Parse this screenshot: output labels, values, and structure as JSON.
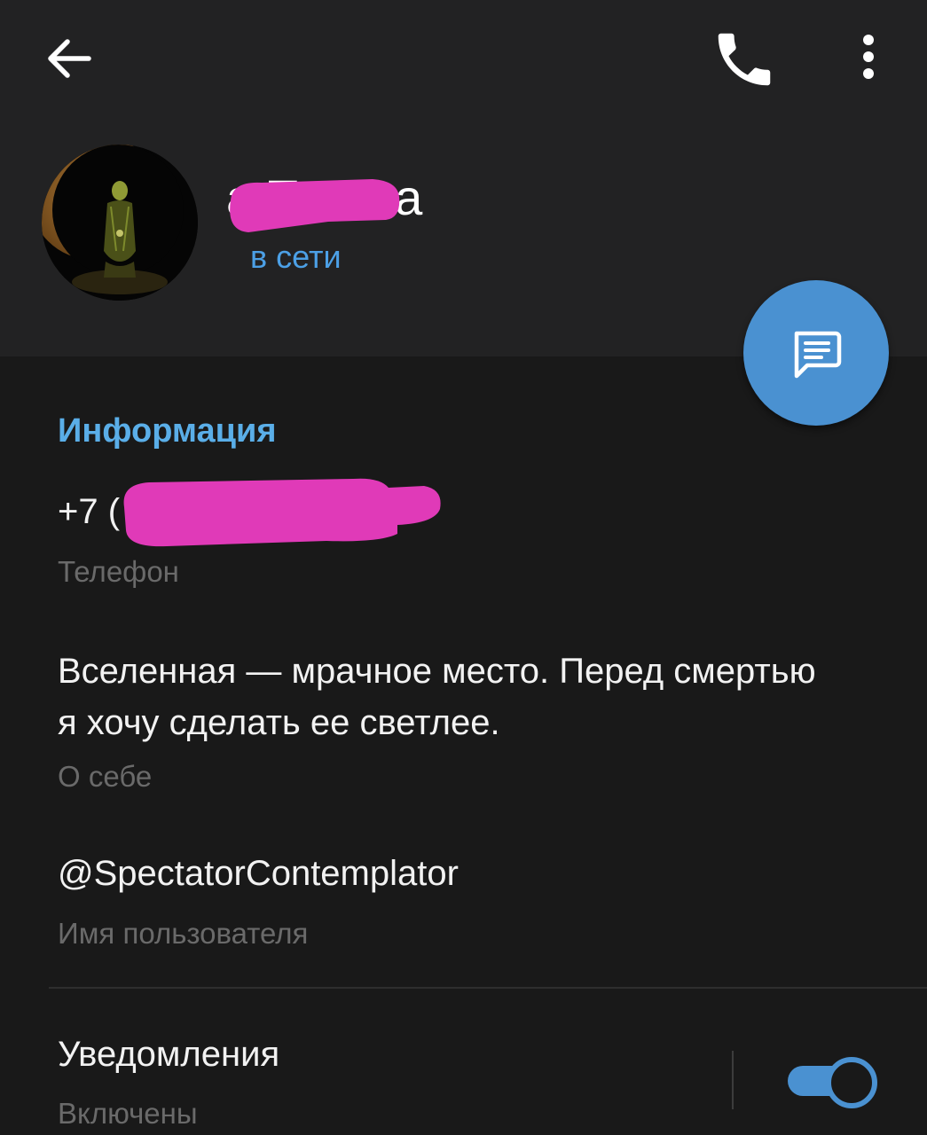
{
  "toolbar": {
    "back_icon": "arrow-back-icon",
    "call_icon": "phone-icon",
    "more_icon": "more-vertical-icon"
  },
  "profile": {
    "name_visible": "а Телега",
    "status": "в сети",
    "accent_color": "#4ca0e6"
  },
  "fab": {
    "icon": "message-icon",
    "color": "#4a91d1"
  },
  "info": {
    "section_title": "Информация",
    "phone": {
      "value": "+7 (",
      "label": "Телефон"
    },
    "bio": {
      "value": "Вселенная — мрачное место. Перед смертью я хочу сделать ее светлее.",
      "label": "О себе"
    },
    "username": {
      "value": "@SpectatorContemplator",
      "label": "Имя пользователя"
    }
  },
  "notifications": {
    "title": "Уведомления",
    "status": "Включены",
    "enabled": true
  },
  "colors": {
    "background": "#191919",
    "header_background": "#222223",
    "redaction": "#e03ab8"
  }
}
